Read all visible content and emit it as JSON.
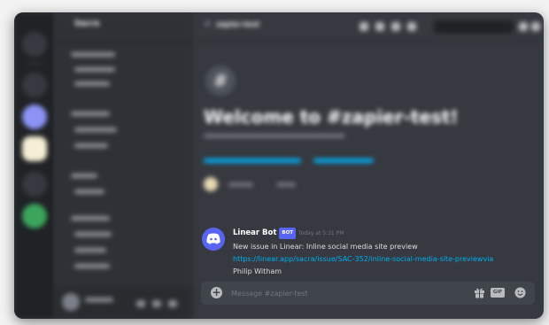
{
  "header": {
    "server_name": "Sacra",
    "channel_name": "zapier-test"
  },
  "welcome": {
    "title": "Welcome to #zapier-test!"
  },
  "message": {
    "author": "Linear Bot",
    "bot_tag": "BOT",
    "timestamp": "Today at 5:31 PM",
    "line1": "New issue in Linear: Inline social media site preview",
    "link": "https://linear.app/sacra/issue/SAC-352/inline-social-media-site-previewvia",
    "assignee": " Philip Witham"
  },
  "composer": {
    "placeholder": "Message #zapier-test",
    "gif_label": "GIF",
    "add_icon": "plus-circle-icon",
    "gift_icon": "gift-icon",
    "emoji_icon": "emoji-icon"
  },
  "colors": {
    "background": "#36393f",
    "sidebar": "#2f3136",
    "server_rail": "#202225",
    "link": "#00aff4",
    "blurple": "#5865f2"
  }
}
